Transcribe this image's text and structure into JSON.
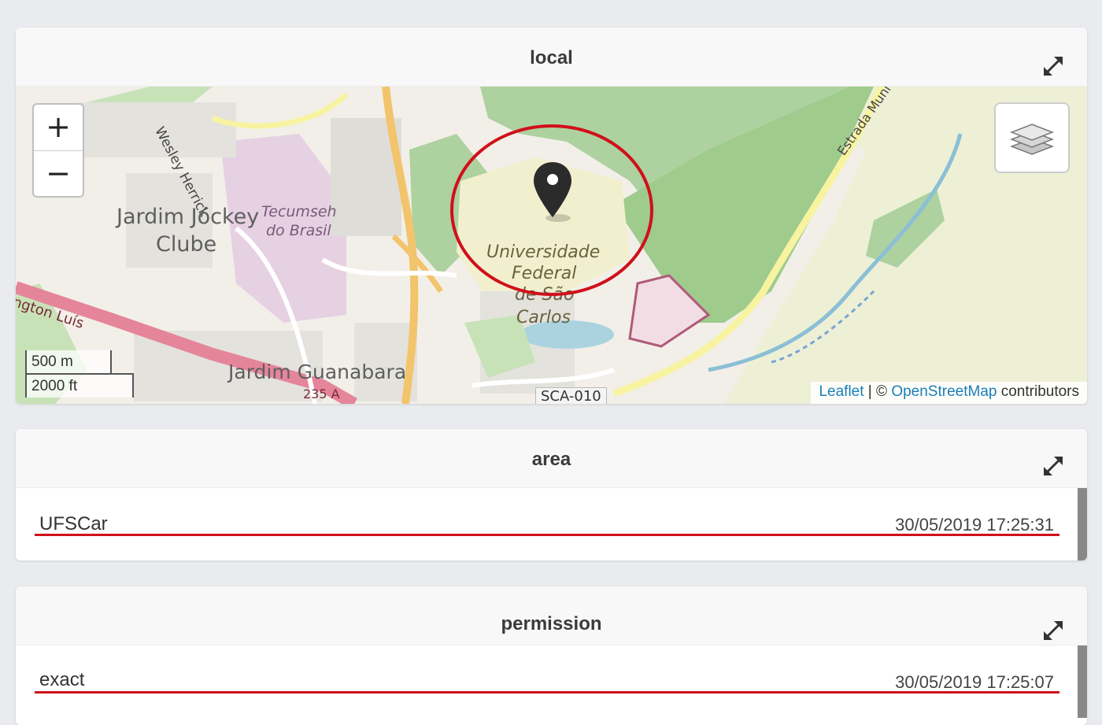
{
  "panels": {
    "local": {
      "title": "local",
      "map": {
        "zoom_in": "+",
        "zoom_out": "−",
        "scale_metric": "500 m",
        "scale_imperial": "2000 ft",
        "attribution": {
          "leaflet": "Leaflet",
          "separator": " | © ",
          "osm": "OpenStreetMap",
          "suffix": " contributors"
        },
        "labels": {
          "wesley": "Wesley Herrick",
          "jardim_jockey": "Jardim Jóckey",
          "clube": "Clube",
          "tecumseh": "Tecumseh",
          "do_brasil": "do Brasil",
          "washington": "ngton Luís",
          "ufscar_1": "Universidade",
          "ufscar_2": "Federal",
          "ufscar_3": "de São",
          "ufscar_4": "Carlos",
          "jardim_guanabara": "Jardim Guanabara",
          "road_235": "235 A",
          "sca_010": "SCA-010",
          "estrada": "Estrada Muni"
        },
        "colors": {
          "marker": "#2b2b2b",
          "highlight_circle": "#d0101a"
        }
      }
    },
    "area": {
      "title": "area",
      "value": "UFSCar",
      "timestamp": "30/05/2019 17:25:31"
    },
    "permission": {
      "title": "permission",
      "value": "exact",
      "timestamp": "30/05/2019 17:25:07"
    }
  }
}
